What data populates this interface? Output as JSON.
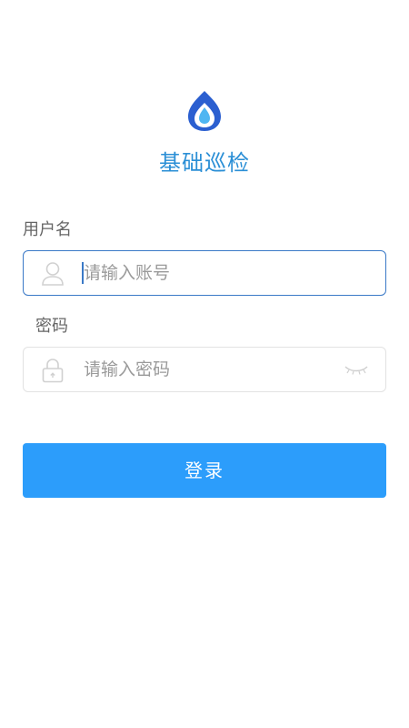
{
  "app": {
    "title": "基础巡检",
    "logo_icon": "water-drop-logo-icon"
  },
  "username": {
    "label": "用户名",
    "placeholder": "请输入账号",
    "value": "",
    "icon": "user-icon"
  },
  "password": {
    "label": "密码",
    "placeholder": "请输入密码",
    "value": "",
    "icon": "lock-icon",
    "toggle_icon": "eye-closed-icon"
  },
  "login_button": {
    "label": "登录"
  },
  "colors": {
    "title": "#2b8fd6",
    "primary_button": "#2c9dfb",
    "focused_border": "#3a79c7",
    "label_text": "#666666",
    "placeholder_text": "#9a9a9a",
    "logo_dark": "#2b5fd0",
    "logo_light": "#4fb6f2"
  }
}
